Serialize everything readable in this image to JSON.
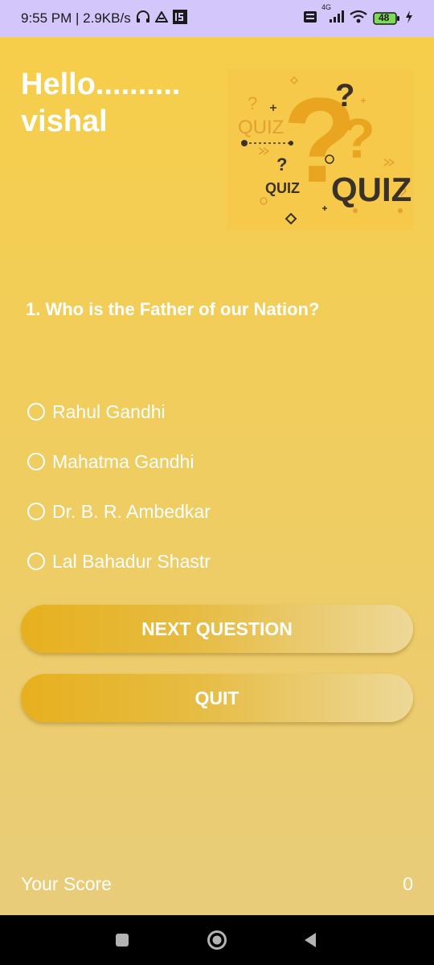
{
  "status_bar": {
    "time_speed": "9:55 PM | 2.9KB/s",
    "network": "4G",
    "battery": "48"
  },
  "header": {
    "greeting_line1": "Hello..........",
    "greeting_line2": "vishal"
  },
  "quiz_image": {
    "words": [
      "QUIZ",
      "QUIZ",
      "QUIZ"
    ]
  },
  "question": {
    "text": "1. Who is the Father of our Nation?",
    "options": [
      "Rahul Gandhi",
      "Mahatma Gandhi",
      "Dr. B. R. Ambedkar",
      "Lal Bahadur Shastr"
    ]
  },
  "buttons": {
    "next": "NEXT QUESTION",
    "quit": "QUIT"
  },
  "score": {
    "label": "Your Score",
    "value": "0"
  },
  "colors": {
    "background_top": "#f7ce4a",
    "background_bottom": "#e8cc7a",
    "button_gradient_start": "#e7b01e",
    "button_gradient_end": "#edd898",
    "status_bar": "#d3c6fb"
  },
  "icons": [
    "headphones-icon",
    "drive-icon",
    "app-badge-icon",
    "volte-icon",
    "signal-icon",
    "wifi-icon",
    "battery-icon",
    "charging-icon",
    "square-nav-icon",
    "home-nav-icon",
    "back-nav-icon"
  ]
}
